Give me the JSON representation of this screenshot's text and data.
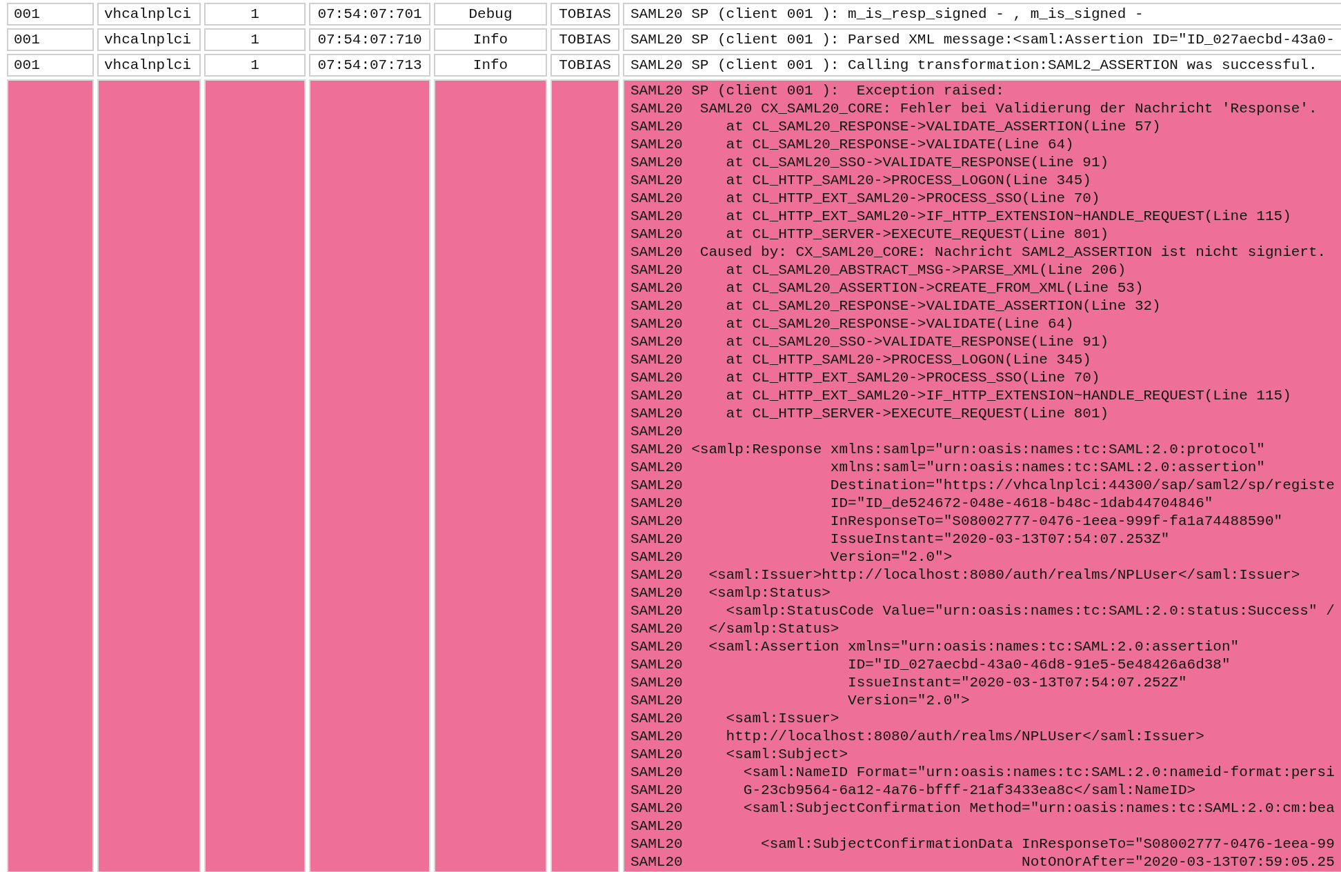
{
  "log_table": {
    "rows": [
      {
        "client": "001",
        "host": "vhcalnplci",
        "column_3": "1",
        "time": "07:54:07:701",
        "level": "Debug",
        "user": "TOBIAS",
        "highlighted": false,
        "message": [
          "SAML20 SP (client 001 ): m_is_resp_signed - , m_is_signed -"
        ]
      },
      {
        "client": "001",
        "host": "vhcalnplci",
        "column_3": "1",
        "time": "07:54:07:710",
        "level": "Info",
        "user": "TOBIAS",
        "highlighted": false,
        "message": [
          "SAML20 SP (client 001 ): Parsed XML message:<saml:Assertion ID=\"ID_027aecbd-43a0-"
        ]
      },
      {
        "client": "001",
        "host": "vhcalnplci",
        "column_3": "1",
        "time": "07:54:07:713",
        "level": "Info",
        "user": "TOBIAS",
        "highlighted": false,
        "message": [
          "SAML20 SP (client 001 ): Calling transformation:SAML2_ASSERTION was successful."
        ]
      },
      {
        "highlighted": true,
        "message": [
          "SAML20 SP (client 001 ):  Exception raised:",
          "SAML20  SAML20 CX_SAML20_CORE: Fehler bei Validierung der Nachricht 'Response'.",
          "SAML20     at CL_SAML20_RESPONSE->VALIDATE_ASSERTION(Line 57)",
          "SAML20     at CL_SAML20_RESPONSE->VALIDATE(Line 64)",
          "SAML20     at CL_SAML20_SSO->VALIDATE_RESPONSE(Line 91)",
          "SAML20     at CL_HTTP_SAML20->PROCESS_LOGON(Line 345)",
          "SAML20     at CL_HTTP_EXT_SAML20->PROCESS_SSO(Line 70)",
          "SAML20     at CL_HTTP_EXT_SAML20->IF_HTTP_EXTENSION~HANDLE_REQUEST(Line 115)",
          "SAML20     at CL_HTTP_SERVER->EXECUTE_REQUEST(Line 801)",
          "SAML20  Caused by: CX_SAML20_CORE: Nachricht SAML2_ASSERTION ist nicht signiert.",
          "SAML20     at CL_SAML20_ABSTRACT_MSG->PARSE_XML(Line 206)",
          "SAML20     at CL_SAML20_ASSERTION->CREATE_FROM_XML(Line 53)",
          "SAML20     at CL_SAML20_RESPONSE->VALIDATE_ASSERTION(Line 32)",
          "SAML20     at CL_SAML20_RESPONSE->VALIDATE(Line 64)",
          "SAML20     at CL_SAML20_SSO->VALIDATE_RESPONSE(Line 91)",
          "SAML20     at CL_HTTP_SAML20->PROCESS_LOGON(Line 345)",
          "SAML20     at CL_HTTP_EXT_SAML20->PROCESS_SSO(Line 70)",
          "SAML20     at CL_HTTP_EXT_SAML20->IF_HTTP_EXTENSION~HANDLE_REQUEST(Line 115)",
          "SAML20     at CL_HTTP_SERVER->EXECUTE_REQUEST(Line 801)",
          "SAML20",
          "SAML20 <samlp:Response xmlns:samlp=\"urn:oasis:names:tc:SAML:2.0:protocol\"",
          "SAML20                 xmlns:saml=\"urn:oasis:names:tc:SAML:2.0:assertion\"",
          "SAML20                 Destination=\"https://vhcalnplci:44300/sap/saml2/sp/registe",
          "SAML20                 ID=\"ID_de524672-048e-4618-b48c-1dab44704846\"",
          "SAML20                 InResponseTo=\"S08002777-0476-1eea-999f-fa1a74488590\"",
          "SAML20                 IssueInstant=\"2020-03-13T07:54:07.253Z\"",
          "SAML20                 Version=\"2.0\">",
          "SAML20   <saml:Issuer>http://localhost:8080/auth/realms/NPLUser</saml:Issuer>",
          "SAML20   <samlp:Status>",
          "SAML20     <samlp:StatusCode Value=\"urn:oasis:names:tc:SAML:2.0:status:Success\" /",
          "SAML20   </samlp:Status>",
          "SAML20   <saml:Assertion xmlns=\"urn:oasis:names:tc:SAML:2.0:assertion\"",
          "SAML20                   ID=\"ID_027aecbd-43a0-46d8-91e5-5e48426a6d38\"",
          "SAML20                   IssueInstant=\"2020-03-13T07:54:07.252Z\"",
          "SAML20                   Version=\"2.0\">",
          "SAML20     <saml:Issuer>",
          "SAML20     http://localhost:8080/auth/realms/NPLUser</saml:Issuer>",
          "SAML20     <saml:Subject>",
          "SAML20       <saml:NameID Format=\"urn:oasis:names:tc:SAML:2.0:nameid-format:persi",
          "SAML20       G-23cb9564-6a12-4a76-bfff-21af3433ea8c</saml:NameID>",
          "SAML20       <saml:SubjectConfirmation Method=\"urn:oasis:names:tc:SAML:2.0:cm:bea",
          "SAML20",
          "SAML20         <saml:SubjectConfirmationData InResponseTo=\"S08002777-0476-1eea-99",
          "SAML20                                       NotOnOrAfter=\"2020-03-13T07:59:05.25"
        ]
      }
    ]
  }
}
